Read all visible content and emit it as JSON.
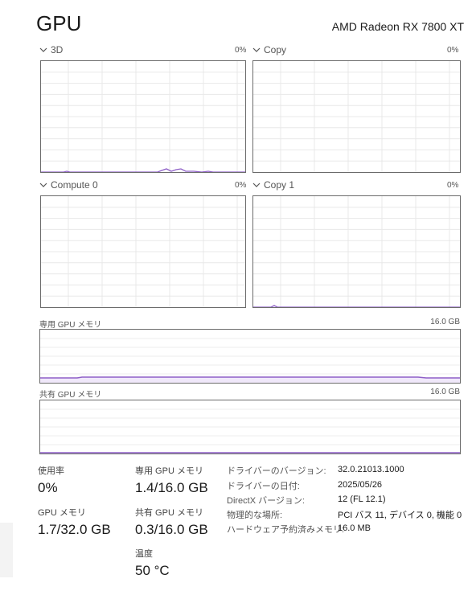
{
  "header": {
    "title": "GPU",
    "gpu_name": "AMD Radeon RX 7800 XT"
  },
  "engines": [
    {
      "label": "3D",
      "percent": "0%"
    },
    {
      "label": "Copy",
      "percent": "0%"
    },
    {
      "label": "Compute 0",
      "percent": "0%"
    },
    {
      "label": "Copy 1",
      "percent": "0%"
    }
  ],
  "memory": {
    "dedicated": {
      "label": "専用 GPU メモリ",
      "max": "16.0 GB"
    },
    "shared": {
      "label": "共有 GPU メモリ",
      "max": "16.0 GB"
    }
  },
  "stats": {
    "utilization": {
      "label": "使用率",
      "value": "0%"
    },
    "dedicated_mem": {
      "label": "専用 GPU メモリ",
      "value": "1.4/16.0 GB"
    },
    "gpu_mem": {
      "label": "GPU メモリ",
      "value": "1.7/32.0 GB"
    },
    "shared_mem": {
      "label": "共有 GPU メモリ",
      "value": "0.3/16.0 GB"
    },
    "temperature": {
      "label": "温度",
      "value": "50 °C"
    }
  },
  "info": [
    {
      "key": "ドライバーのバージョン:",
      "value": "32.0.21013.1000"
    },
    {
      "key": "ドライバーの日付:",
      "value": "2025/05/26"
    },
    {
      "key": "DirectX バージョン:",
      "value": "12 (FL 12.1)"
    },
    {
      "key": "物理的な場所:",
      "value": "PCI バス 11, デバイス 0, 機能 0"
    },
    {
      "key": "ハードウェア予約済みメモリ:",
      "value": "16.0 MB"
    }
  ],
  "colors": {
    "graph_line": "#8e5fc7",
    "graph_fill": "#f0e8fa",
    "grid": "#e8e8e8",
    "border": "#6b6b6b"
  },
  "icons": {
    "expander": "chevron-down-icon"
  }
}
